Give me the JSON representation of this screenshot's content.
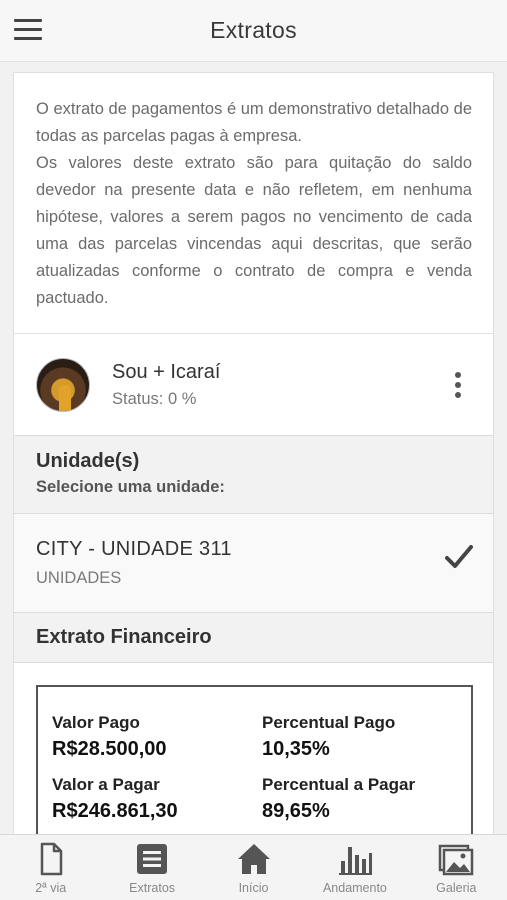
{
  "header": {
    "title": "Extratos"
  },
  "intro": {
    "paragraph1": "O extrato de pagamentos é um demonstrativo detalhado de todas as parcelas pagas à empresa.",
    "paragraph2": "Os valores deste extrato são para quitação do saldo devedor na presente data e não refletem, em nenhuma hipótese, valores a serem pagos no vencimento de cada uma das parcelas vincendas aqui descritas, que serão atualizadas conforme o contrato de compra e venda pactuado."
  },
  "enterprise": {
    "name": "Sou + Icaraí",
    "status": "Status: 0 %"
  },
  "units": {
    "title": "Unidade(s)",
    "subtitle": "Selecione uma unidade:",
    "selected": {
      "name": "CITY - UNIDADE 311",
      "type": "UNIDADES"
    }
  },
  "financial": {
    "title": "Extrato Financeiro",
    "items": [
      {
        "label": "Valor Pago",
        "value": "R$28.500,00"
      },
      {
        "label": "Percentual Pago",
        "value": "10,35%"
      },
      {
        "label": "Valor a Pagar",
        "value": "R$246.861,30"
      },
      {
        "label": "Percentual a Pagar",
        "value": "89,65%"
      }
    ]
  },
  "tabs": [
    {
      "label": "2ª via",
      "icon": "document-icon"
    },
    {
      "label": "Extratos",
      "icon": "list-icon"
    },
    {
      "label": "Início",
      "icon": "home-icon"
    },
    {
      "label": "Andamento",
      "icon": "bar-chart-icon"
    },
    {
      "label": "Galeria",
      "icon": "gallery-icon"
    }
  ],
  "colors": {
    "icon": "#555555",
    "header_bg": "#f7f7f7",
    "section_bg": "#f2f2f2"
  }
}
